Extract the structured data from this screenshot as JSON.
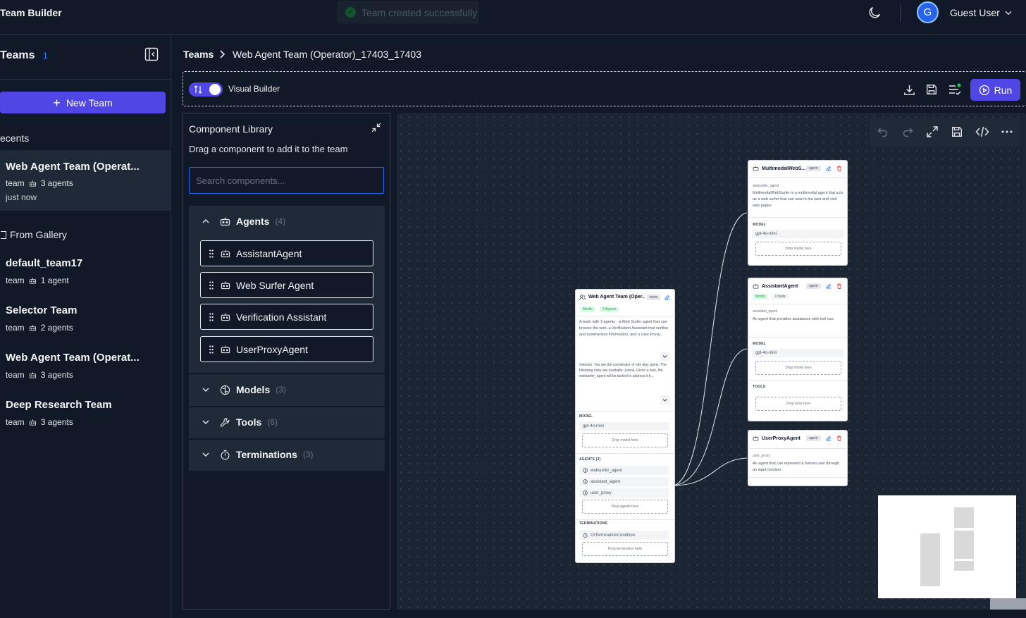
{
  "app": {
    "title": "Team Builder"
  },
  "toast": {
    "message": "Team created successfully"
  },
  "user": {
    "initial": "G",
    "name": "Guest User"
  },
  "sidebar": {
    "heading": "Teams",
    "count": "1",
    "new_team_label": "New Team",
    "recents_label": "ecents",
    "gallery_label": "From Gallery",
    "recents": [
      {
        "name": "Web Agent Team (Operat...",
        "kind": "team",
        "agents": "3 agents",
        "time": "just now"
      }
    ],
    "gallery": [
      {
        "name": "default_team17",
        "kind": "team",
        "agents": "1 agent"
      },
      {
        "name": "Selector Team",
        "kind": "team",
        "agents": "2 agents"
      },
      {
        "name": "Web Agent Team (Operat...",
        "kind": "team",
        "agents": "3 agents"
      },
      {
        "name": "Deep Research Team",
        "kind": "team",
        "agents": "3 agents"
      }
    ]
  },
  "breadcrumb": {
    "root": "Teams",
    "current": "Web Agent Team (Operator)_17403_17403"
  },
  "toolbar": {
    "visual_builder_label": "Visual Builder",
    "visual_builder_on": true,
    "run_label": "Run"
  },
  "library": {
    "title": "Component Library",
    "subtitle": "Drag a component to add it to the team",
    "search_placeholder": "Search components...",
    "sections": [
      {
        "label": "Agents",
        "count": "(4)",
        "expanded": true,
        "items": [
          "AssistantAgent",
          "Web Surfer Agent",
          "Verification Assistant",
          "UserProxyAgent"
        ]
      },
      {
        "label": "Models",
        "count": "(3)",
        "expanded": false
      },
      {
        "label": "Tools",
        "count": "(6)",
        "expanded": false
      },
      {
        "label": "Terminations",
        "count": "(3)",
        "expanded": false
      }
    ]
  },
  "nodes": {
    "team": {
      "title": "Web Agent Team (Oper...",
      "tag": "team",
      "badge_model": "Model",
      "badge_agents": "3 Agents",
      "description": "A team with 3 agents - a Web Surfer agent that can browse the web, a Verification Assistant that verifies and summarizes information, and a User Proxy...",
      "selector_text": "Selector: You are the coordinator of role play game. The following roles are available: {roles}. Given a task, the websurfer_agent will be tasked to address it b...",
      "model_label": "MODEL",
      "model_value": "gpt-4o-mini",
      "drop_model": "Drop model here",
      "agents_label": "AGENTS (3)",
      "agents": [
        "websurfer_agent",
        "assistant_agent",
        "user_proxy"
      ],
      "drop_agents": "Drop agents here",
      "terminations_label": "TERMINATIONS",
      "termination": "OrTerminationCondition",
      "drop_termination": "Drop termination here"
    },
    "websurfer": {
      "title": "MultimodalWebS...",
      "tag": "agent",
      "name": "websurfer_agent",
      "description": "MultimodalWebSurfer is a multimodal agent that acts as a web surfer that can search the web and visit web pages.",
      "model_label": "MODEL",
      "model_value": "gpt-4o-mini",
      "drop_model": "Drop model here"
    },
    "assistant": {
      "title": "AssistantAgent",
      "tag": "agent",
      "badge_model": "Model",
      "tools_count": "0 tools",
      "name": "assistant_agent",
      "description": "An agent that provides assistance with tool use.",
      "model_label": "MODEL",
      "model_value": "gpt-4o-mini",
      "drop_model": "Drop model here",
      "tools_label": "TOOLS",
      "drop_tools": "Drop tools here"
    },
    "userproxy": {
      "title": "UserProxyAgent",
      "tag": "agent",
      "name": "user_proxy",
      "description": "An agent that can represent a human user through an input function."
    }
  },
  "colors": {
    "accent": "#4f46e5",
    "background": "#111827",
    "canvas": "#1c2534",
    "link": "#3b82f6"
  }
}
